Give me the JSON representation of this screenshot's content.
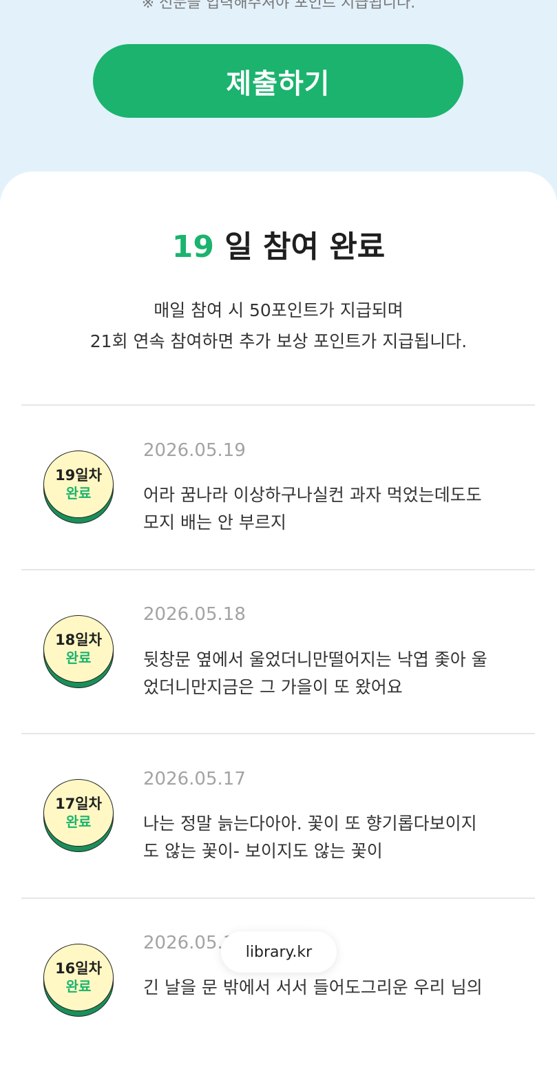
{
  "notice": "※ 전문을 입력해주셔야 포인트 지급됩니다.",
  "submit_label": "제출하기",
  "summary": {
    "days": "19",
    "suffix": " 일 참여 완료",
    "line1": "매일 참여 시 50포인트가 지급되며",
    "line2": "21회 연속 참여하면 추가 보상 포인트가 지급됩니다."
  },
  "entries": [
    {
      "badge_day": "19일차",
      "badge_status": "완료",
      "date": "2026.05.19",
      "line1": "어라 꿈나라 이상하구나실컨 과자 먹었는데도도",
      "line2": "모지 배는 안 부르지"
    },
    {
      "badge_day": "18일차",
      "badge_status": "완료",
      "date": "2026.05.18",
      "line1": "뒷창문 옆에서 울었더니만떨어지는 낙엽 좇아 울",
      "line2": "었더니만지금은 그 가을이 또 왔어요"
    },
    {
      "badge_day": "17일차",
      "badge_status": "완료",
      "date": "2026.05.17",
      "line1": "나는 정말 늙는다아아. 꽃이 또 향기롭다보이지",
      "line2": "도 않는 꽃이- 보이지도 않는 꽃이"
    },
    {
      "badge_day": "16일차",
      "badge_status": "완료",
      "date": "2026.05.16",
      "line1": "긴 날을 문 밖에서 서서 들어도그리운 우리 님의",
      "line2": ""
    }
  ],
  "url_label": "library.kr"
}
